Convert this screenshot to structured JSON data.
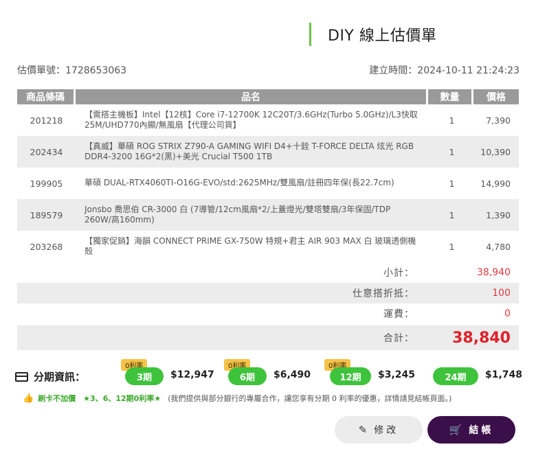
{
  "header": {
    "title": "DIY 線上估價單"
  },
  "meta": {
    "quote_no": "估價單號：1728653063",
    "created": "建立時間：2024-10-11 21:24:23"
  },
  "table": {
    "headers": {
      "code": "商品條碼",
      "name": "品名",
      "qty": "數量",
      "price": "價格"
    },
    "rows": [
      {
        "code": "201218",
        "name": "【需搭主機板】Intel【12核】Core i7-12700K 12C20T/3.6GHz(Turbo 5.0GHz)/L3快取25M/UHD770內顯/無風扇【代理公司貨】",
        "qty": "1",
        "price": "7,390"
      },
      {
        "code": "202434",
        "name": "【真威】華碩 ROG STRIX Z790-A GAMING WIFI D4+十銓 T-FORCE DELTA 炫光 RGB DDR4-3200 16G*2(黑)+美光 Crucial T500 1TB",
        "qty": "1",
        "price": "10,390"
      },
      {
        "code": "199905",
        "name": "華碩 DUAL-RTX4060TI-O16G-EVO/std:2625MHz/雙風扇/註冊四年保(長22.7cm)",
        "qty": "1",
        "price": "14,990"
      },
      {
        "code": "189579",
        "name": "Jonsbo 喬思伯 CR-3000 白 (7導管/12cm風扇*2/上蓋燈光/雙塔雙扇/3年保固/TDP 260W/高160mm)",
        "qty": "1",
        "price": "1,390"
      },
      {
        "code": "203268",
        "name": "【獨家促銷】海韻 CONNECT PRIME GX-750W 特規+君主 AIR 903 MAX 白 玻璃透側機殼",
        "qty": "1",
        "price": "4,780"
      }
    ]
  },
  "summary": {
    "subtotal_label": "小計：",
    "subtotal": "38,940",
    "discount_label": "仕意搭折抵：",
    "discount": "100",
    "shipping_label": "運費：",
    "shipping": "0",
    "total_label": "合計：",
    "total": "38,840"
  },
  "installment": {
    "label": "分期資訊：",
    "plans": [
      {
        "badge": "0利率",
        "term": "3期",
        "amount": "$12,947"
      },
      {
        "badge": "0利率",
        "term": "6期",
        "amount": "$6,490"
      },
      {
        "badge": "0利率",
        "term": "12期",
        "amount": "$3,245"
      },
      {
        "badge": "",
        "term": "24期",
        "amount": "$1,748"
      }
    ]
  },
  "note": {
    "highlight": "刷卡不加價　★3、6、12期0利率★",
    "text": "(我們提供與部分銀行的專屬合作，讓您享有分期 0 利率的優惠，詳情請見結帳頁面。)"
  },
  "buttons": {
    "edit": "修改",
    "checkout": "結帳"
  },
  "colors": {
    "accent_green": "#3fc33d",
    "price_red": "#e0202a",
    "checkout_purple": "#3b0f4a",
    "badge_yellow": "#f4c247"
  }
}
